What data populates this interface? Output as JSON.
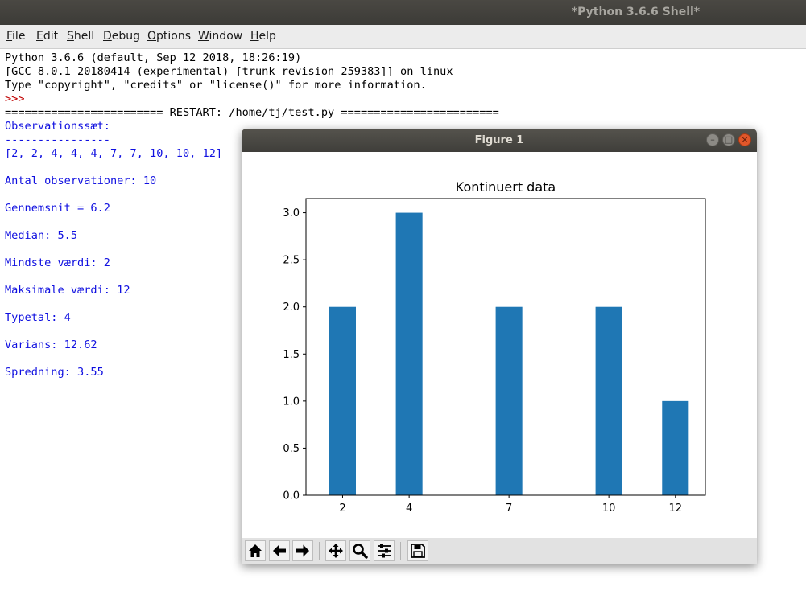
{
  "app": {
    "window_title": "*Python 3.6.6 Shell*"
  },
  "menu": [
    "File",
    "Edit",
    "Shell",
    "Debug",
    "Options",
    "Window",
    "Help"
  ],
  "shell": {
    "lines": [
      {
        "text": "Python 3.6.6 (default, Sep 12 2018, 18:26:19)",
        "kind": "std"
      },
      {
        "text": "[GCC 8.0.1 20180414 (experimental) [trunk revision 259383]] on linux",
        "kind": "std"
      },
      {
        "text": "Type \"copyright\", \"credits\" or \"license()\" for more information.",
        "kind": "std"
      },
      {
        "text": ">>>",
        "kind": "prompt"
      },
      {
        "text": "======================== RESTART: /home/tj/test.py ========================",
        "kind": "std"
      },
      {
        "text": "Observationssæt:",
        "kind": "out"
      },
      {
        "text": "----------------",
        "kind": "out"
      },
      {
        "text": "[2, 2, 4, 4, 4, 7, 7, 10, 10, 12]",
        "kind": "out"
      },
      {
        "text": "",
        "kind": "out"
      },
      {
        "text": "Antal observationer: 10",
        "kind": "out"
      },
      {
        "text": "",
        "kind": "out"
      },
      {
        "text": "Gennemsnit = 6.2",
        "kind": "out"
      },
      {
        "text": "",
        "kind": "out"
      },
      {
        "text": "Median: 5.5",
        "kind": "out"
      },
      {
        "text": "",
        "kind": "out"
      },
      {
        "text": "Mindste værdi: 2",
        "kind": "out"
      },
      {
        "text": "",
        "kind": "out"
      },
      {
        "text": "Maksimale værdi: 12",
        "kind": "out"
      },
      {
        "text": "",
        "kind": "out"
      },
      {
        "text": "Typetal: 4",
        "kind": "out"
      },
      {
        "text": "",
        "kind": "out"
      },
      {
        "text": "Varians: 12.62",
        "kind": "out"
      },
      {
        "text": "",
        "kind": "out"
      },
      {
        "text": "Spredning: 3.55",
        "kind": "out"
      }
    ]
  },
  "figure": {
    "title": "Figure 1",
    "buttons": {
      "minimize": "–",
      "maximize": "□",
      "close": "×"
    },
    "toolbar": [
      "home-icon",
      "back-arrow-icon",
      "forward-arrow-icon",
      "pan-icon",
      "zoom-icon",
      "configure-subplots-icon",
      "save-icon"
    ]
  },
  "chart_data": {
    "type": "bar",
    "title": "Kontinuert data",
    "xlabel": "",
    "ylabel": "",
    "x": [
      2,
      4,
      7,
      10,
      12
    ],
    "values": [
      2,
      3,
      2,
      2,
      1
    ],
    "bar_width": 0.8,
    "xlim": [
      0.9,
      12.9
    ],
    "ylim": [
      0,
      3.15
    ],
    "yticks": [
      0.0,
      0.5,
      1.0,
      1.5,
      2.0,
      2.5,
      3.0
    ],
    "ytick_labels": [
      "0.0",
      "0.5",
      "1.0",
      "1.5",
      "2.0",
      "2.5",
      "3.0"
    ],
    "xtick_labels": [
      "2",
      "4",
      "7",
      "10",
      "12"
    ],
    "grid": false,
    "bar_color": "#1f77b4"
  }
}
